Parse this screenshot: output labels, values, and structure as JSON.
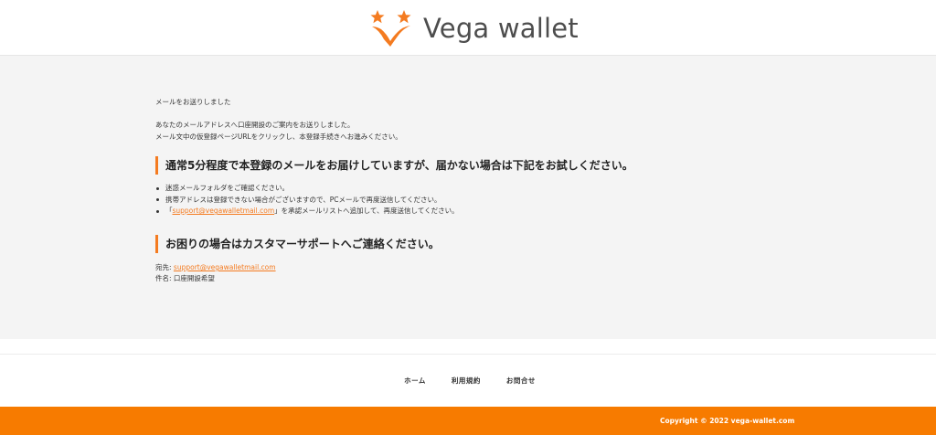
{
  "header": {
    "logo_text": "Vega wallet",
    "brand_color": "#f47b20",
    "logo_icon": "stars-v-icon"
  },
  "main": {
    "title": "メールをお送りしました",
    "intro_lines": [
      "あなたのメールアドレスへ口座開設のご案内をお送りしました。",
      "メール文中の仮登録ページURLをクリックし、本登録手続きへお進みください。"
    ],
    "section1": {
      "heading": "通常5分程度で本登録のメールをお届けしていますが、届かない場合は下記をお試しください。",
      "bullets": {
        "b1": "迷惑メールフォルダをご確認ください。",
        "b2": "携帯アドレスは登録できない場合がございますので、PCメールで再度送信してください。",
        "b3_prefix": "「",
        "b3_link": "support@vegawalletmail.com",
        "b3_suffix": "」を承認メールリストへ追加して、再度送信してください。"
      }
    },
    "section2": {
      "heading": "お困りの場合はカスタマーサポートへご連絡ください。",
      "to_label": "宛先: ",
      "to_email": "support@vegawalletmail.com",
      "subject": "件名: 口座開設希望"
    }
  },
  "footer": {
    "nav": {
      "home": "ホーム",
      "terms": "利用規約",
      "contact": "お問合せ"
    },
    "copyright": "Copyright © 2022 vega-wallet.com",
    "bar_color": "#f77b00"
  }
}
